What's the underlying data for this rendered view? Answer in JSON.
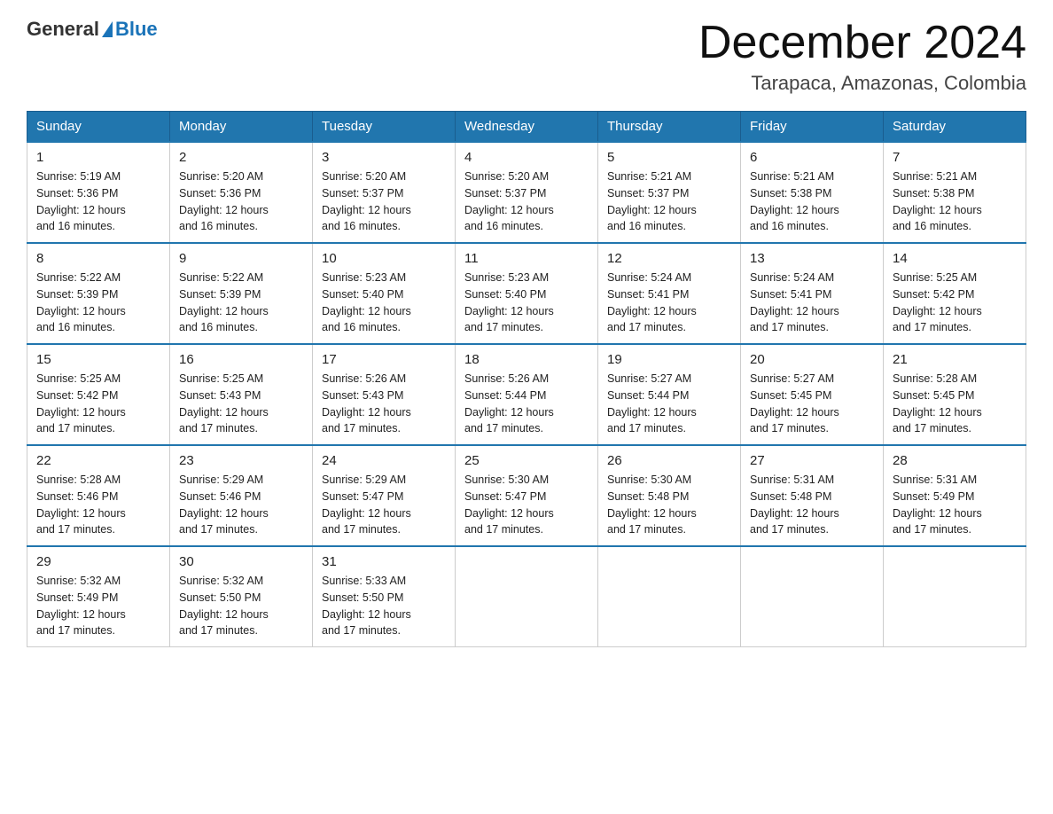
{
  "logo": {
    "general": "General",
    "blue": "Blue"
  },
  "title": "December 2024",
  "location": "Tarapaca, Amazonas, Colombia",
  "days_of_week": [
    "Sunday",
    "Monday",
    "Tuesday",
    "Wednesday",
    "Thursday",
    "Friday",
    "Saturday"
  ],
  "weeks": [
    [
      {
        "day": "1",
        "sunrise": "5:19 AM",
        "sunset": "5:36 PM",
        "daylight": "12 hours and 16 minutes."
      },
      {
        "day": "2",
        "sunrise": "5:20 AM",
        "sunset": "5:36 PM",
        "daylight": "12 hours and 16 minutes."
      },
      {
        "day": "3",
        "sunrise": "5:20 AM",
        "sunset": "5:37 PM",
        "daylight": "12 hours and 16 minutes."
      },
      {
        "day": "4",
        "sunrise": "5:20 AM",
        "sunset": "5:37 PM",
        "daylight": "12 hours and 16 minutes."
      },
      {
        "day": "5",
        "sunrise": "5:21 AM",
        "sunset": "5:37 PM",
        "daylight": "12 hours and 16 minutes."
      },
      {
        "day": "6",
        "sunrise": "5:21 AM",
        "sunset": "5:38 PM",
        "daylight": "12 hours and 16 minutes."
      },
      {
        "day": "7",
        "sunrise": "5:21 AM",
        "sunset": "5:38 PM",
        "daylight": "12 hours and 16 minutes."
      }
    ],
    [
      {
        "day": "8",
        "sunrise": "5:22 AM",
        "sunset": "5:39 PM",
        "daylight": "12 hours and 16 minutes."
      },
      {
        "day": "9",
        "sunrise": "5:22 AM",
        "sunset": "5:39 PM",
        "daylight": "12 hours and 16 minutes."
      },
      {
        "day": "10",
        "sunrise": "5:23 AM",
        "sunset": "5:40 PM",
        "daylight": "12 hours and 16 minutes."
      },
      {
        "day": "11",
        "sunrise": "5:23 AM",
        "sunset": "5:40 PM",
        "daylight": "12 hours and 17 minutes."
      },
      {
        "day": "12",
        "sunrise": "5:24 AM",
        "sunset": "5:41 PM",
        "daylight": "12 hours and 17 minutes."
      },
      {
        "day": "13",
        "sunrise": "5:24 AM",
        "sunset": "5:41 PM",
        "daylight": "12 hours and 17 minutes."
      },
      {
        "day": "14",
        "sunrise": "5:25 AM",
        "sunset": "5:42 PM",
        "daylight": "12 hours and 17 minutes."
      }
    ],
    [
      {
        "day": "15",
        "sunrise": "5:25 AM",
        "sunset": "5:42 PM",
        "daylight": "12 hours and 17 minutes."
      },
      {
        "day": "16",
        "sunrise": "5:25 AM",
        "sunset": "5:43 PM",
        "daylight": "12 hours and 17 minutes."
      },
      {
        "day": "17",
        "sunrise": "5:26 AM",
        "sunset": "5:43 PM",
        "daylight": "12 hours and 17 minutes."
      },
      {
        "day": "18",
        "sunrise": "5:26 AM",
        "sunset": "5:44 PM",
        "daylight": "12 hours and 17 minutes."
      },
      {
        "day": "19",
        "sunrise": "5:27 AM",
        "sunset": "5:44 PM",
        "daylight": "12 hours and 17 minutes."
      },
      {
        "day": "20",
        "sunrise": "5:27 AM",
        "sunset": "5:45 PM",
        "daylight": "12 hours and 17 minutes."
      },
      {
        "day": "21",
        "sunrise": "5:28 AM",
        "sunset": "5:45 PM",
        "daylight": "12 hours and 17 minutes."
      }
    ],
    [
      {
        "day": "22",
        "sunrise": "5:28 AM",
        "sunset": "5:46 PM",
        "daylight": "12 hours and 17 minutes."
      },
      {
        "day": "23",
        "sunrise": "5:29 AM",
        "sunset": "5:46 PM",
        "daylight": "12 hours and 17 minutes."
      },
      {
        "day": "24",
        "sunrise": "5:29 AM",
        "sunset": "5:47 PM",
        "daylight": "12 hours and 17 minutes."
      },
      {
        "day": "25",
        "sunrise": "5:30 AM",
        "sunset": "5:47 PM",
        "daylight": "12 hours and 17 minutes."
      },
      {
        "day": "26",
        "sunrise": "5:30 AM",
        "sunset": "5:48 PM",
        "daylight": "12 hours and 17 minutes."
      },
      {
        "day": "27",
        "sunrise": "5:31 AM",
        "sunset": "5:48 PM",
        "daylight": "12 hours and 17 minutes."
      },
      {
        "day": "28",
        "sunrise": "5:31 AM",
        "sunset": "5:49 PM",
        "daylight": "12 hours and 17 minutes."
      }
    ],
    [
      {
        "day": "29",
        "sunrise": "5:32 AM",
        "sunset": "5:49 PM",
        "daylight": "12 hours and 17 minutes."
      },
      {
        "day": "30",
        "sunrise": "5:32 AM",
        "sunset": "5:50 PM",
        "daylight": "12 hours and 17 minutes."
      },
      {
        "day": "31",
        "sunrise": "5:33 AM",
        "sunset": "5:50 PM",
        "daylight": "12 hours and 17 minutes."
      },
      null,
      null,
      null,
      null
    ]
  ],
  "labels": {
    "sunrise": "Sunrise:",
    "sunset": "Sunset:",
    "daylight": "Daylight:"
  }
}
